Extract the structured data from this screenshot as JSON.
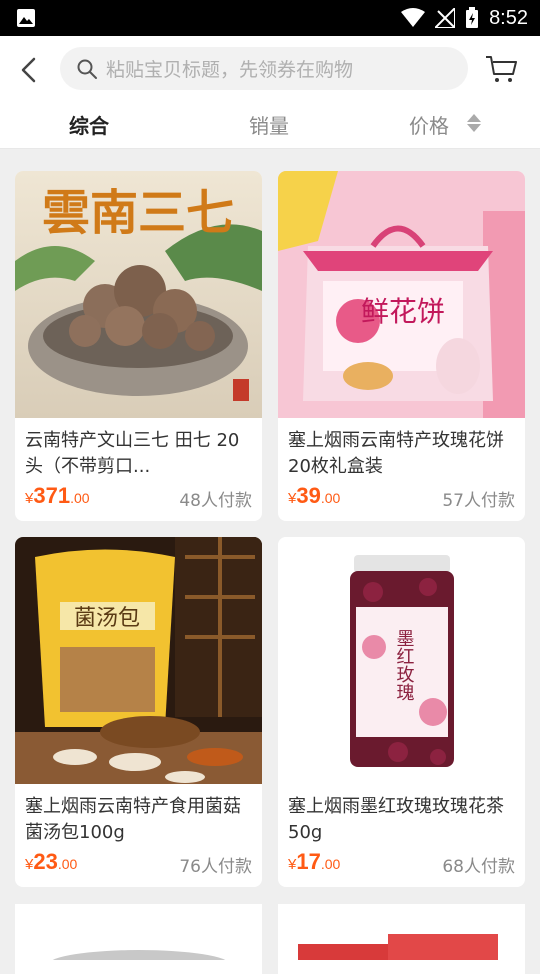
{
  "status_bar": {
    "time": "8:52"
  },
  "search": {
    "placeholder": "粘贴宝贝标题，先领券在购物"
  },
  "tabs": [
    {
      "label": "综合",
      "active": true
    },
    {
      "label": "销量",
      "active": false
    },
    {
      "label": "价格",
      "active": false
    }
  ],
  "products": [
    {
      "image_text": "雲南三七",
      "title": "云南特产文山三七 田七 20头（不带剪口...",
      "currency": "¥",
      "price_int": "371",
      "price_dec": ".00",
      "sold": "48人付款"
    },
    {
      "image_text": "鲜花饼",
      "title": "塞上烟雨云南特产玫瑰花饼20枚礼盒装",
      "currency": "¥",
      "price_int": "39",
      "price_dec": ".00",
      "sold": "57人付款"
    },
    {
      "image_text": "菌汤包",
      "title": "塞上烟雨云南特产食用菌菇菌汤包100g",
      "currency": "¥",
      "price_int": "23",
      "price_dec": ".00",
      "sold": "76人付款"
    },
    {
      "image_text": "墨红玫瑰",
      "title": "塞上烟雨墨红玫瑰玫瑰花茶50g",
      "currency": "¥",
      "price_int": "17",
      "price_dec": ".00",
      "sold": "68人付款"
    }
  ],
  "colors": {
    "price": "#ff5a14",
    "background": "#efefef"
  }
}
